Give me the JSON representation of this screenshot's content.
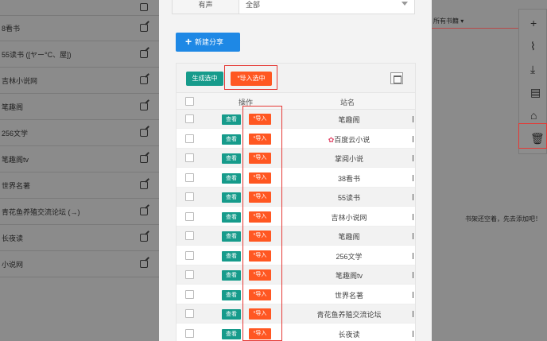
{
  "left_list": {
    "top_item": "… … …",
    "items": [
      {
        "label": "8看书"
      },
      {
        "label": "55读书 ([ヤー°C、屋])"
      },
      {
        "label": "吉林小说网"
      },
      {
        "label": "笔趣阁"
      },
      {
        "label": "256文学"
      },
      {
        "label": "笔趣阁tv"
      },
      {
        "label": "世界名著"
      },
      {
        "label": "青花鱼养殖交流论坛 (→)"
      },
      {
        "label": "长夜读"
      },
      {
        "label": "小说网"
      }
    ]
  },
  "filter": {
    "label": "有声",
    "value": "全部"
  },
  "new_share": {
    "label": "新建分享",
    "icon": "plus-icon"
  },
  "toolbar": {
    "generate_label": "生成选中",
    "import_label": "*导入选中"
  },
  "table": {
    "headers": {
      "op": "操作",
      "site": "站名"
    },
    "view_label": "查看",
    "import_label": "*导入",
    "rows": [
      {
        "site": "笔趣阁"
      },
      {
        "site": "百度云小说",
        "flower": "✿"
      },
      {
        "site": "掌阅小说"
      },
      {
        "site": "38看书"
      },
      {
        "site": "55读书"
      },
      {
        "site": "吉林小说网"
      },
      {
        "site": "笔趣阁"
      },
      {
        "site": "256文学"
      },
      {
        "site": "笔趣阁tv"
      },
      {
        "site": "世界名著"
      },
      {
        "site": "青花鱼养殖交流论坛"
      },
      {
        "site": "长夜读"
      }
    ]
  },
  "right_panel": {
    "top_tab": "所有书籍 ▾",
    "empty_text": "书架还空着，先去添加吧！"
  },
  "fab": {
    "icons": [
      "plus-icon",
      "leaf-icon",
      "download-icon",
      "list-icon",
      "bank-icon",
      "trash-icon"
    ],
    "glyphs": [
      "+",
      "⌇",
      "⤓",
      "▤",
      "⌂",
      "🗑"
    ]
  },
  "colors": {
    "accent": "#1e88e5",
    "teal": "#169b8b",
    "orange": "#ff5722",
    "highlight": "#e53935"
  }
}
